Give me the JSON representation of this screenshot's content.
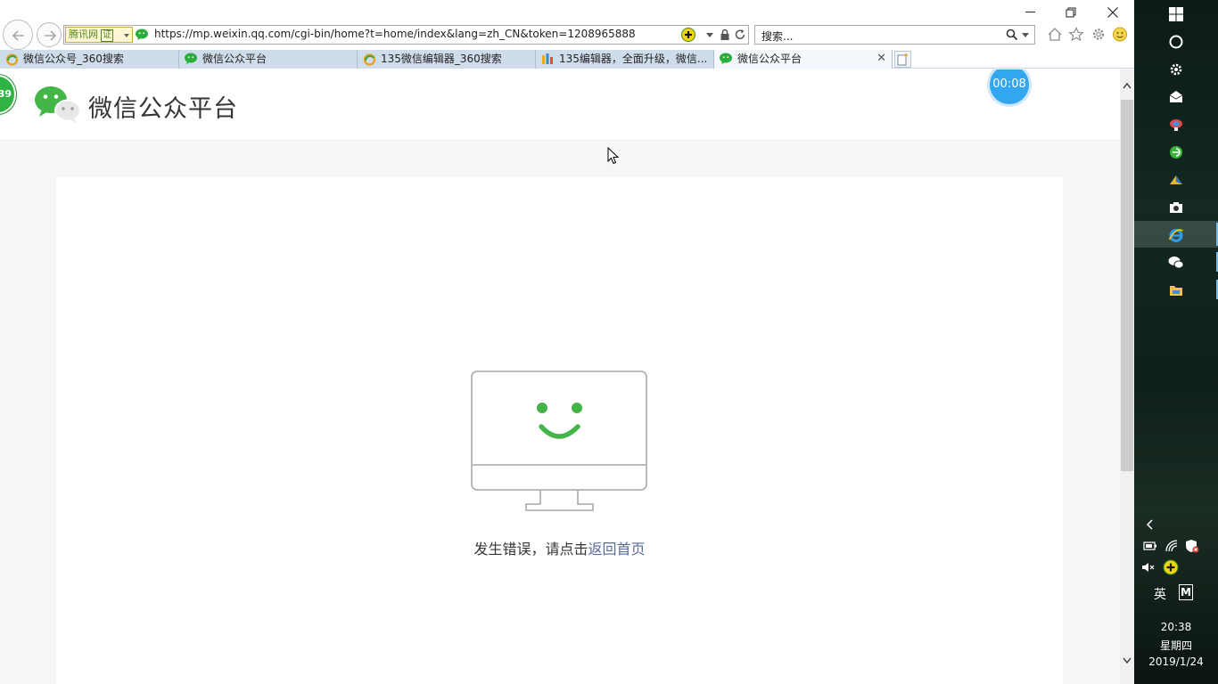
{
  "browser": {
    "cert_badge_label": "腾讯网",
    "cert_badge_box": "证",
    "url": "https://mp.weixin.qq.com/cgi-bin/home?t=home/index&lang=zh_CN&token=1208965888",
    "search_text": "搜索..."
  },
  "tabs": [
    {
      "label": "微信公众号_360搜索",
      "icon": "360-search-icon",
      "active": false
    },
    {
      "label": "微信公众平台",
      "icon": "wechat-icon",
      "active": false
    },
    {
      "label": "135微信编辑器_360搜索",
      "icon": "360-search-icon",
      "active": false
    },
    {
      "label": "135编辑器，全面升级，微信...",
      "icon": "135-editor-icon",
      "active": false
    },
    {
      "label": "微信公众平台",
      "icon": "wechat-icon",
      "active": true
    }
  ],
  "page": {
    "site_title": "微信公众平台",
    "timer": "00:08",
    "side_counter": "39",
    "error_text": "发生错误，请点击",
    "error_link": "返回首页"
  },
  "taskbar": {
    "items": [
      "windows-start-icon",
      "cortana-circle-icon",
      "settings-icon",
      "mail-icon",
      "app-icon",
      "360-browser-icon",
      "app-icon",
      "camera-icon",
      "ie-icon",
      "wechat-icon",
      "file-explorer-icon"
    ],
    "active_item": "ie-icon",
    "lang": "英",
    "ime": "M",
    "time": "20:38",
    "weekday": "星期四",
    "date": "2019/1/24"
  },
  "colors": {
    "wechat_green": "#44b549",
    "link_blue": "#576b95",
    "timer_blue": "#33a6f0",
    "tab_inactive": "#cfdcea"
  }
}
